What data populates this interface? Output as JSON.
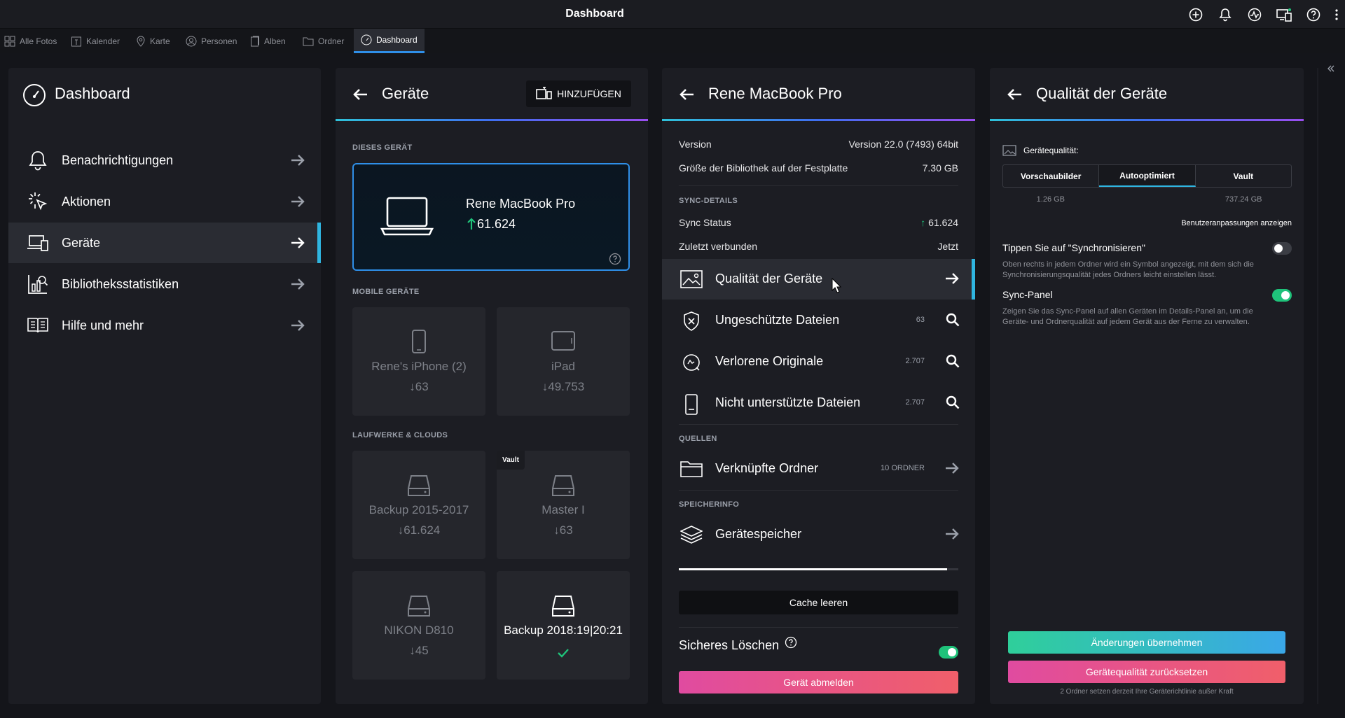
{
  "window": {
    "title": "Dashboard"
  },
  "top_icons": [
    "add-circle-icon",
    "bell-icon",
    "activity-icon",
    "devices-sync-icon",
    "help-icon",
    "more-vertical-icon"
  ],
  "tabs": [
    {
      "label": "Alle Fotos",
      "icon": "grid-icon"
    },
    {
      "label": "Kalender",
      "icon": "calendar-icon"
    },
    {
      "label": "Karte",
      "icon": "map-pin-icon"
    },
    {
      "label": "Personen",
      "icon": "person-icon"
    },
    {
      "label": "Alben",
      "icon": "album-icon"
    },
    {
      "label": "Ordner",
      "icon": "folder-icon"
    },
    {
      "label": "Dashboard",
      "icon": "gauge-icon",
      "active": true
    }
  ],
  "nav": {
    "title": "Dashboard",
    "items": [
      {
        "label": "Benachrichtigungen",
        "icon": "bell-icon"
      },
      {
        "label": "Aktionen",
        "icon": "click-icon"
      },
      {
        "label": "Geräte",
        "icon": "laptop-icon",
        "active": true
      },
      {
        "label": "Bibliotheksstatistiken",
        "icon": "stats-icon"
      },
      {
        "label": "Hilfe und mehr",
        "icon": "book-help-icon"
      }
    ]
  },
  "devices": {
    "title": "Geräte",
    "add_label": "HINZUFÜGEN",
    "this_device_section": "DIESES GERÄT",
    "this_device": {
      "name": "Rene MacBook Pro",
      "count": "61.624"
    },
    "mobile_section": "MOBILE GERÄTE",
    "mobile": [
      {
        "name": "Rene's iPhone (2)",
        "count": "63"
      },
      {
        "name": "iPad",
        "count": "49.753"
      }
    ],
    "drives_section": "LAUFWERKE & CLOUDS",
    "drives": [
      {
        "name": "Backup 2015-2017",
        "count": "61.624",
        "badge": ""
      },
      {
        "name": "Master I",
        "count": "63",
        "badge": "Vault"
      },
      {
        "name": "NIKON D810",
        "count": "45",
        "badge": ""
      },
      {
        "name": "Backup 2018:19|20:21",
        "count": "",
        "badge": ""
      }
    ]
  },
  "detail": {
    "title": "Rene MacBook Pro",
    "version_label": "Version",
    "version_value": "Version 22.0 (7493) 64bit",
    "size_label": "Größe der Bibliothek auf der Festplatte",
    "size_value": "7.30 GB",
    "sync_section": "SYNC-DETAILS",
    "sync_status_label": "Sync Status",
    "sync_status_value": "61.624",
    "last_label": "Zuletzt verbunden",
    "last_value": "Jetzt",
    "rows": [
      {
        "label": "Qualität der Geräte",
        "value": "",
        "icon": "image-quality-icon"
      },
      {
        "label": "Ungeschützte Dateien",
        "value": "63",
        "icon": "shield-x-icon"
      },
      {
        "label": "Verlorene Originale",
        "value": "2.707",
        "icon": "lost-icon"
      },
      {
        "label": "Nicht unterstützte Dateien",
        "value": "2.707",
        "icon": "file-icon"
      }
    ],
    "sources_section": "QUELLEN",
    "sources_label": "Verknüpfte Ordner",
    "sources_value": "10 ORDNER",
    "storage_section": "SPEICHERINFO",
    "storage_label": "Gerätespeicher",
    "storage_fill": 0.96,
    "cache_button": "Cache leeren",
    "secure_delete_label": "Sicheres Löschen",
    "secure_delete_on": true,
    "logout_button": "Gerät abmelden"
  },
  "quality": {
    "title": "Qualität der Geräte",
    "label": "Gerätequalität:",
    "options": [
      {
        "label": "Vorschaubilder",
        "size": "1.26 GB"
      },
      {
        "label": "Autooptimiert",
        "size": "",
        "active": true
      },
      {
        "label": "Vault",
        "size": "737.24 GB"
      }
    ],
    "custom_link": "Benutzeranpassungen anzeigen",
    "tip_title": "Tippen Sie auf \"Synchronisieren\"",
    "tip_text": "Oben rechts in jedem Ordner wird ein Symbol angezeigt, mit dem sich die Synchronisierungsqualität jedes Ordners leicht einstellen lässt.",
    "tip_on": false,
    "panel_title": "Sync-Panel",
    "panel_text": "Zeigen Sie das Sync-Panel auf allen Geräten im Details-Panel an, um die Geräte- und Ordnerqualität auf jedem Gerät aus der Ferne zu verwalten.",
    "panel_on": true,
    "apply_button": "Änderungen übernehmen",
    "reset_button": "Gerätequalität zurücksetzen",
    "footer_note": "2 Ordner setzen derzeit Ihre Geräterichtlinie außer Kraft"
  },
  "colors": {
    "accent": "#2fb5e0",
    "green": "#1fc27a",
    "pink": "#e8457a"
  }
}
